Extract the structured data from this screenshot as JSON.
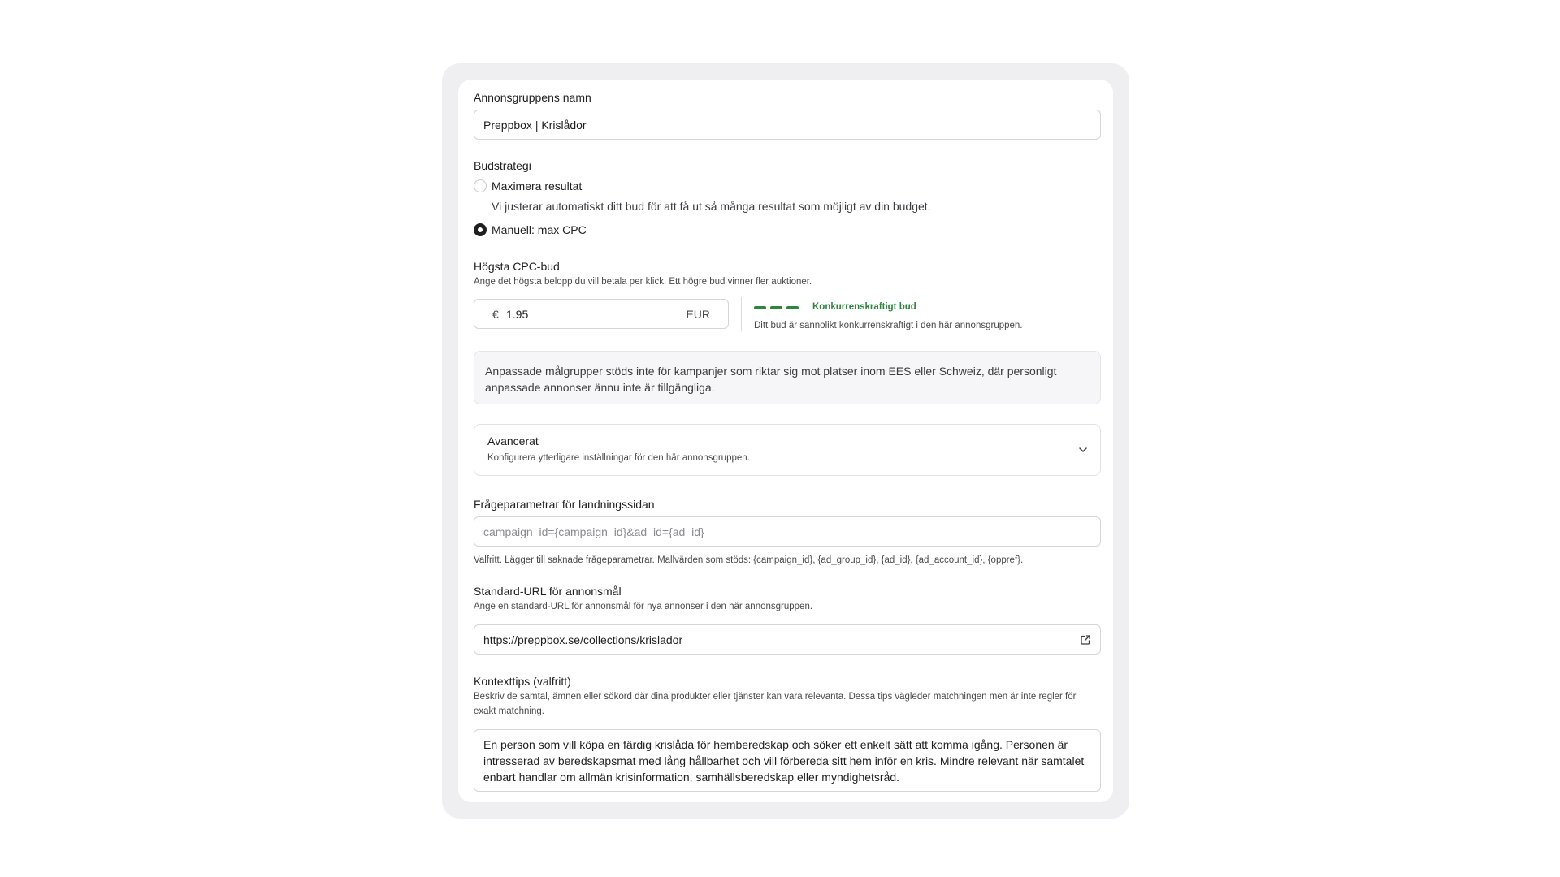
{
  "ad_group_name": {
    "label": "Annonsgruppens namn",
    "value": "Preppbox | Krislådor"
  },
  "bid_strategy": {
    "label": "Budstrategi",
    "options": [
      {
        "label": "Maximera resultat",
        "description": "Vi justerar automatiskt ditt bud för att få ut så många resultat som möjligt av din budget.",
        "selected": false
      },
      {
        "label": "Manuell: max CPC",
        "selected": true
      }
    ]
  },
  "max_cpc": {
    "label": "Högsta CPC-bud",
    "hint": "Ange det högsta belopp du vill betala per klick. Ett högre bud vinner fler auktioner.",
    "currency_symbol": "€",
    "value": "1.95",
    "currency_code": "EUR",
    "indicator_label": "Konkurrenskraftigt bud",
    "indicator_description": "Ditt bud är sannolikt konkurrenskraftigt i den här annonsgruppen.",
    "indicator_color": "#2e8540"
  },
  "notice": {
    "text": "Anpassade målgrupper stöds inte för kampanjer som riktar sig mot platser inom EES eller Schweiz, där personligt anpassade annonser ännu inte är tillgängliga."
  },
  "advanced": {
    "title": "Avancerat",
    "subtitle": "Konfigurera ytterligare inställningar för den här annonsgruppen.",
    "icon": "chevron-down-icon"
  },
  "query_params": {
    "label": "Frågeparametrar för landningssidan",
    "placeholder": "campaign_id={campaign_id}&ad_id={ad_id}",
    "hint": "Valfritt. Lägger till saknade frågeparametrar. Mallvärden som stöds: {campaign_id}, {ad_group_id}, {ad_id}, {ad_account_id}, {oppref}."
  },
  "default_url": {
    "label": "Standard-URL för annonsmål",
    "hint": "Ange en standard-URL för annonsmål för nya annonser i den här annonsgruppen.",
    "value": "https://preppbox.se/collections/krislador",
    "icon": "external-link-icon"
  },
  "context_tips": {
    "label": "Kontexttips (valfritt)",
    "hint": "Beskriv de samtal, ämnen eller sökord där dina produkter eller tjänster kan vara relevanta. Dessa tips vägleder matchningen men är inte regler för exakt matchning.",
    "value": "En person som vill köpa en färdig krislåda för hemberedskap och söker ett enkelt sätt att komma igång. Personen är intresserad av beredskapsmat med lång hållbarhet och vill förbereda sitt hem inför en kris. Mindre relevant när samtalet enbart handlar om allmän krisinformation, samhällsberedskap eller myndighetsråd."
  }
}
